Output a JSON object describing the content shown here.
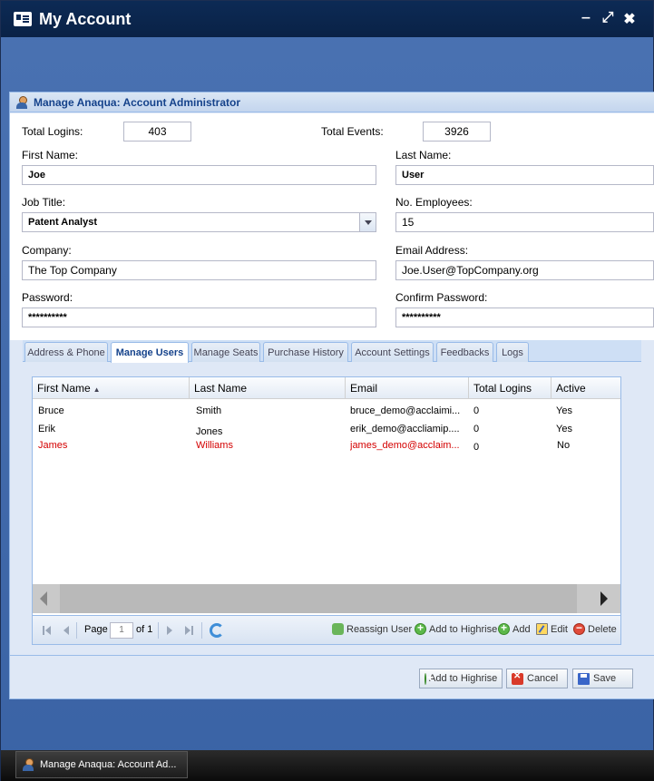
{
  "window": {
    "title": "My Account"
  },
  "dialog": {
    "title": "Manage Anaqua: Account Administrator"
  },
  "form": {
    "total_logins_label": "Total Logins:",
    "total_logins_value": "403",
    "total_events_label": "Total Events:",
    "total_events_value": "3926",
    "first_name_label": "First Name:",
    "first_name_value": "Joe",
    "last_name_label": "Last Name:",
    "last_name_value": "User",
    "job_title_label": "Job Title:",
    "job_title_value": "Patent Analyst",
    "employees_label": "No. Employees:",
    "employees_value": "15",
    "company_label": "Company:",
    "company_value": "The Top Company",
    "email_label": "Email Address:",
    "email_value": "Joe.User@TopCompany.org",
    "password_label": "Password:",
    "password_value": "**********",
    "confirm_password_label": "Confirm Password:",
    "confirm_password_value": "**********"
  },
  "tabs": [
    {
      "label": "Address & Phone"
    },
    {
      "label": "Manage Users"
    },
    {
      "label": "Manage Seats"
    },
    {
      "label": "Purchase History"
    },
    {
      "label": "Account Settings"
    },
    {
      "label": "Feedbacks"
    },
    {
      "label": "Logs"
    }
  ],
  "grid": {
    "columns": [
      "First Name",
      "Last Name",
      "Email",
      "Total Logins",
      "Active"
    ],
    "rows": [
      {
        "first": "Bruce",
        "last": "Smith",
        "email": "bruce_demo@acclaimi...",
        "logins": "0",
        "active": "Yes"
      },
      {
        "first": "Erik",
        "last": "Jones",
        "email": "erik_demo@accliamip....",
        "logins": "0",
        "active": "Yes"
      },
      {
        "first": "James",
        "last": "Williams",
        "email": "james_demo@acclaim...",
        "logins": "0",
        "active": "No"
      }
    ]
  },
  "pager": {
    "page_label": "Page",
    "page_value": "1",
    "of_label": "of 1"
  },
  "toolbar": {
    "reassign": "Reassign User",
    "add_highrise": "Add to Highrise",
    "add": "Add",
    "edit": "Edit",
    "delete": "Delete"
  },
  "footer": {
    "add_highrise": "Add to Highrise",
    "cancel": "Cancel",
    "save": "Save"
  },
  "taskbar": {
    "item": "Manage Anaqua: Account Ad..."
  }
}
